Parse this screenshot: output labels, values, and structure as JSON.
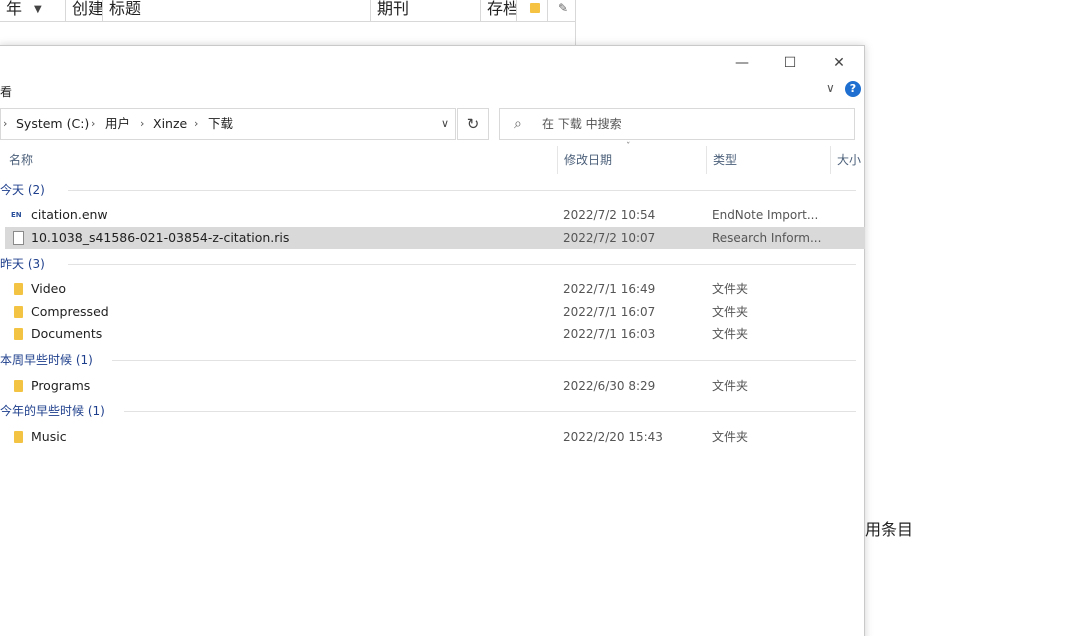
{
  "background_app": {
    "columns": [
      {
        "label": "年",
        "has_caret": true
      },
      {
        "label": "创建"
      },
      {
        "label": "标题"
      },
      {
        "label": "期刊"
      },
      {
        "label": "存档"
      }
    ],
    "side_text": "用条目"
  },
  "window": {
    "controls": {
      "minimize": "—",
      "maximize": "☐",
      "close": "✕"
    },
    "ribbon_text": "看",
    "ribbon_chevron": "∨",
    "help": "?",
    "address": {
      "leading_chevron": "›",
      "crumbs": [
        "System (C:)",
        "用户",
        "Xinze",
        "下载"
      ],
      "separator": "›",
      "dropdown": "∨"
    },
    "refresh": "↻",
    "search": {
      "icon": "⌕",
      "placeholder": "在 下载 中搜索"
    },
    "columns": {
      "name": "名称",
      "modified": "修改日期",
      "type": "类型",
      "size": "大小",
      "sort_indicator": "ˇ"
    },
    "groups": [
      {
        "label": "今天 (2)",
        "items": [
          {
            "name": "citation.enw",
            "date": "2022/7/2 10:54",
            "type": "EndNote Import...",
            "icon": "endnote-file-icon",
            "icon_glyph": "EN",
            "selected": false
          },
          {
            "name": "10.1038_s41586-021-03854-z-citation.ris",
            "date": "2022/7/2 10:07",
            "type": "Research Inform...",
            "icon": "file-icon",
            "selected": true
          }
        ]
      },
      {
        "label": "昨天 (3)",
        "items": [
          {
            "name": "Video",
            "date": "2022/7/1 16:49",
            "type": "文件夹",
            "icon": "folder-icon",
            "selected": false
          },
          {
            "name": "Compressed",
            "date": "2022/7/1 16:07",
            "type": "文件夹",
            "icon": "folder-icon",
            "selected": false
          },
          {
            "name": "Documents",
            "date": "2022/7/1 16:03",
            "type": "文件夹",
            "icon": "folder-icon",
            "selected": false
          }
        ]
      },
      {
        "label": "本周早些时候 (1)",
        "items": [
          {
            "name": "Programs",
            "date": "2022/6/30 8:29",
            "type": "文件夹",
            "icon": "folder-icon",
            "selected": false
          }
        ]
      },
      {
        "label": "今年的早些时候 (1)",
        "items": [
          {
            "name": "Music",
            "date": "2022/2/20 15:43",
            "type": "文件夹",
            "icon": "folder-icon",
            "selected": false
          }
        ]
      }
    ]
  },
  "colors": {
    "group_label": "#1e3f8c",
    "selected_row": "#d9d9d9",
    "folder": "#f3c344",
    "help": "#1e6fd0"
  }
}
